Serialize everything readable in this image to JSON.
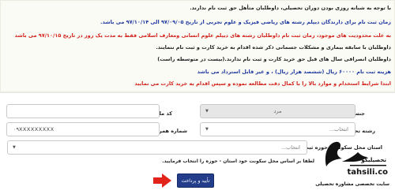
{
  "notice": {
    "lines": [
      {
        "text": "با توجه به شبانه روزی بودن دوران تحصیلی، داوطلبان متأهل حق ثبت نام ندارند.",
        "color": "#222222"
      },
      {
        "text": "زمان ثبت نام برای دارندگان دیپلم رشته های ریاضی فیزیک و علوم تجربی از تاریخ ۹۷/۰۹/۰۵ الی ۹۷/۱۰/۱۴ می باشد.",
        "color": "#1f3a9f"
      },
      {
        "text": "به علت محدودیت های موجود، زمان ثبت نام داوطلبان رشته های دیپلم علوم انسانی ومعارف اسلامی فقط به مدت یک روز در تاریخ ۹۷/۱۰/۱۵ می باشد",
        "color": "#d3231c"
      },
      {
        "text": "داوطلبان با سابقه بیماری و مشکلات جسمانی ذکر شده اقدام به خرید کارت و ثبت نام ننمایند.",
        "color": "#222222"
      },
      {
        "text": "داوطلبان انصرافی سال های قبل حق خرید کارت و ثبت نام ندارند.(بیست در متوسطه راست)",
        "color": "#222222"
      },
      {
        "text": "هزینه ثبت نام ۶۰۰۰۰ ریال (ششصد هزار ریال) ، و غیر قابل استرداد می باشد",
        "color": "#1f3a9f"
      },
      {
        "text": "ابتدا شرایط استخدام و موارد بالا را با کمال دقت مطالعه نموده و سپس اقدام به خرید کارت می نمایید",
        "color": "#d3231c"
      }
    ]
  },
  "form": {
    "gender": {
      "label": "جنسیت",
      "value": "مرد"
    },
    "national_code": {
      "label": "کد ملی",
      "value": ""
    },
    "study_field": {
      "label": "رشته تحصیلی",
      "placeholder": "انتخاب..."
    },
    "mobile": {
      "label": "شماره همراه",
      "value": "۰۹XXXXXXXXX"
    },
    "province": {
      "label": "استان محل سکونت - حوزه ثبت نام",
      "placeholder": "انتخاب..."
    },
    "hint": "لطفا بر اساس محل سکونت خود استان - حوزه را انتخاب فرمایید.",
    "submit_label": "تأیید و پرداخت"
  },
  "branding": {
    "site": "tahsili.co",
    "slogan": "سایت تخصصی مشاوره تحصیلی",
    "logo_text": "تحصیلیکو"
  },
  "colors": {
    "blue_text": "#1f3a9f",
    "red_text": "#d3231c",
    "button": "#233d8a",
    "arrow": "#e2231a"
  }
}
